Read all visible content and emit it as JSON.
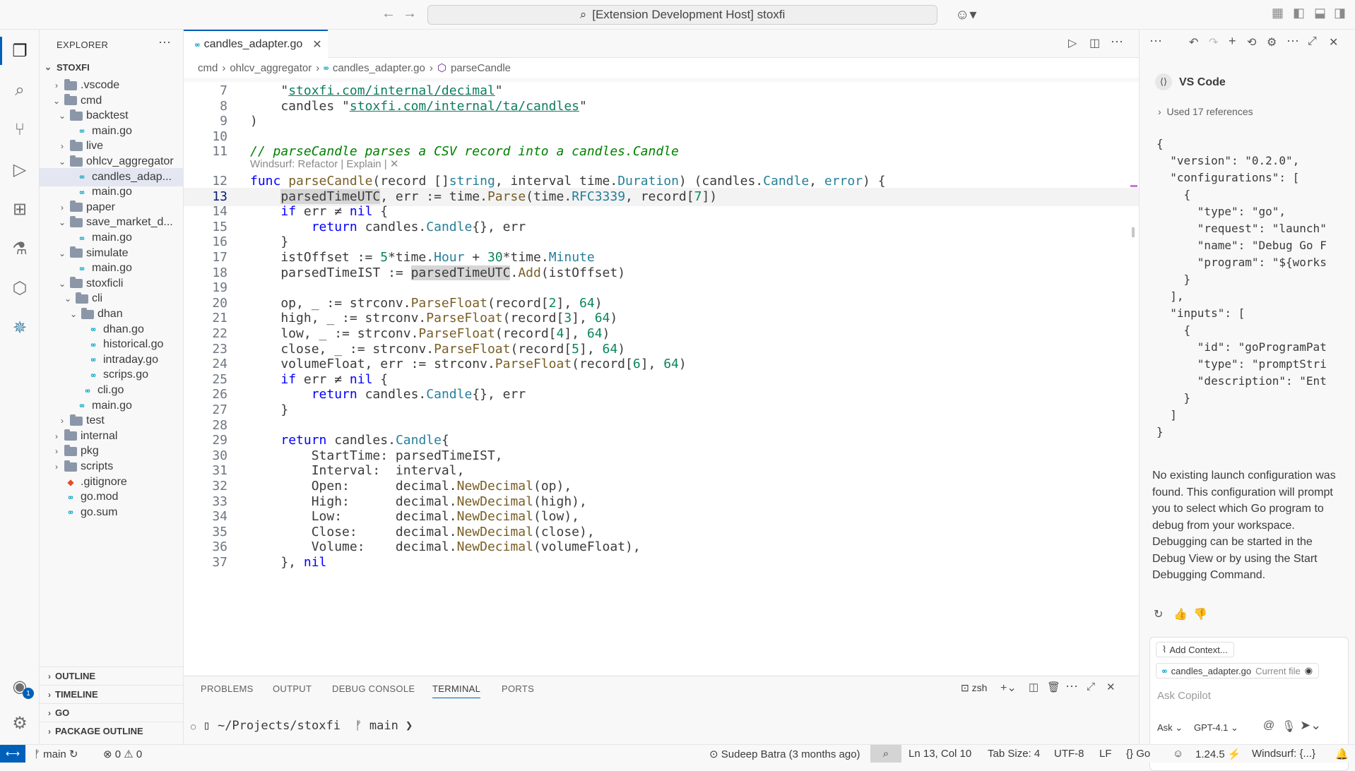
{
  "title_bar": {
    "command_center": "[Extension Development Host] stoxfi"
  },
  "explorer": {
    "header": "EXPLORER",
    "root": "STOXFI",
    "items": [
      {
        "label": ".vscode",
        "depth": 1,
        "kind": "folder",
        "open": false
      },
      {
        "label": "cmd",
        "depth": 1,
        "kind": "folder",
        "open": true
      },
      {
        "label": "backtest",
        "depth": 2,
        "kind": "folder",
        "open": true
      },
      {
        "label": "main.go",
        "depth": 3,
        "kind": "go"
      },
      {
        "label": "live",
        "depth": 2,
        "kind": "folder",
        "open": false
      },
      {
        "label": "ohlcv_aggregator",
        "depth": 2,
        "kind": "folder",
        "open": true
      },
      {
        "label": "candles_adap...",
        "depth": 3,
        "kind": "go",
        "selected": true
      },
      {
        "label": "main.go",
        "depth": 3,
        "kind": "go"
      },
      {
        "label": "paper",
        "depth": 2,
        "kind": "folder",
        "open": false
      },
      {
        "label": "save_market_d...",
        "depth": 2,
        "kind": "folder",
        "open": true
      },
      {
        "label": "main.go",
        "depth": 3,
        "kind": "go"
      },
      {
        "label": "simulate",
        "depth": 2,
        "kind": "folder",
        "open": true
      },
      {
        "label": "main.go",
        "depth": 3,
        "kind": "go"
      },
      {
        "label": "stoxficli",
        "depth": 2,
        "kind": "folder",
        "open": true
      },
      {
        "label": "cli",
        "depth": 3,
        "kind": "folder",
        "open": true
      },
      {
        "label": "dhan",
        "depth": 4,
        "kind": "folder",
        "open": true
      },
      {
        "label": "dhan.go",
        "depth": 5,
        "kind": "go"
      },
      {
        "label": "historical.go",
        "depth": 5,
        "kind": "go"
      },
      {
        "label": "intraday.go",
        "depth": 5,
        "kind": "go"
      },
      {
        "label": "scrips.go",
        "depth": 5,
        "kind": "go"
      },
      {
        "label": "cli.go",
        "depth": 4,
        "kind": "go"
      },
      {
        "label": "main.go",
        "depth": 3,
        "kind": "go"
      },
      {
        "label": "test",
        "depth": 2,
        "kind": "folder",
        "open": false
      },
      {
        "label": "internal",
        "depth": 1,
        "kind": "folder",
        "open": false
      },
      {
        "label": "pkg",
        "depth": 1,
        "kind": "folder",
        "open": false
      },
      {
        "label": "scripts",
        "depth": 1,
        "kind": "folder",
        "open": false
      },
      {
        "label": ".gitignore",
        "depth": 1,
        "kind": "git"
      },
      {
        "label": "go.mod",
        "depth": 1,
        "kind": "go"
      },
      {
        "label": "go.sum",
        "depth": 1,
        "kind": "go"
      }
    ],
    "sections": [
      "OUTLINE",
      "TIMELINE",
      "GO",
      "PACKAGE OUTLINE"
    ]
  },
  "editor": {
    "tab_label": "candles_adapter.go",
    "breadcrumb": [
      "cmd",
      "ohlcv_aggregator",
      "candles_adapter.go",
      "parseCandle"
    ],
    "codelens": "Windsurf: Refactor | Explain | ✕",
    "lines": [
      {
        "n": "7",
        "text": "    \"stoxfi.com/internal/decimal\""
      },
      {
        "n": "8",
        "text": "    candles \"stoxfi.com/internal/ta/candles\""
      },
      {
        "n": "9",
        "text": ")"
      },
      {
        "n": "10",
        "text": ""
      },
      {
        "n": "11",
        "text": "// parseCandle parses a CSV record into a candles.Candle"
      },
      {
        "n": "12",
        "text": "func parseCandle(record []string, interval time.Duration) (candles.Candle, error) {"
      },
      {
        "n": "13",
        "text": "    parsedTimeUTC, err := time.Parse(time.RFC3339, record[7])"
      },
      {
        "n": "14",
        "text": "    if err ≠ nil {"
      },
      {
        "n": "15",
        "text": "        return candles.Candle{}, err"
      },
      {
        "n": "16",
        "text": "    }"
      },
      {
        "n": "17",
        "text": "    istOffset := 5*time.Hour + 30*time.Minute"
      },
      {
        "n": "18",
        "text": "    parsedTimeIST := parsedTimeUTC.Add(istOffset)"
      },
      {
        "n": "19",
        "text": ""
      },
      {
        "n": "20",
        "text": "    op, _ := strconv.ParseFloat(record[2], 64)"
      },
      {
        "n": "21",
        "text": "    high, _ := strconv.ParseFloat(record[3], 64)"
      },
      {
        "n": "22",
        "text": "    low, _ := strconv.ParseFloat(record[4], 64)"
      },
      {
        "n": "23",
        "text": "    close, _ := strconv.ParseFloat(record[5], 64)"
      },
      {
        "n": "24",
        "text": "    volumeFloat, err := strconv.ParseFloat(record[6], 64)"
      },
      {
        "n": "25",
        "text": "    if err ≠ nil {"
      },
      {
        "n": "26",
        "text": "        return candles.Candle{}, err"
      },
      {
        "n": "27",
        "text": "    }"
      },
      {
        "n": "28",
        "text": ""
      },
      {
        "n": "29",
        "text": "    return candles.Candle{"
      },
      {
        "n": "30",
        "text": "        StartTime: parsedTimeIST,"
      },
      {
        "n": "31",
        "text": "        Interval:  interval,"
      },
      {
        "n": "32",
        "text": "        Open:      decimal.NewDecimal(op),"
      },
      {
        "n": "33",
        "text": "        High:      decimal.NewDecimal(high),"
      },
      {
        "n": "34",
        "text": "        Low:       decimal.NewDecimal(low),"
      },
      {
        "n": "35",
        "text": "        Close:     decimal.NewDecimal(close),"
      },
      {
        "n": "36",
        "text": "        Volume:    decimal.NewDecimal(volumeFloat),"
      },
      {
        "n": "37",
        "text": "    }, nil"
      }
    ]
  },
  "panel": {
    "tabs": [
      "PROBLEMS",
      "OUTPUT",
      "DEBUG CONSOLE",
      "TERMINAL",
      "PORTS"
    ],
    "active_tab": "TERMINAL",
    "shell": "zsh",
    "prompt": "~/Projects/stoxfi",
    "branch": "main"
  },
  "chat": {
    "author": "VS Code",
    "references": "Used 17 references",
    "json_lines": [
      "{",
      "  \"version\": \"0.2.0\",",
      "  \"configurations\": [",
      "    {",
      "      \"type\": \"go\",",
      "      \"request\": \"launch\"",
      "      \"name\": \"Debug Go F",
      "      \"program\": \"${works",
      "    }",
      "  ],",
      "  \"inputs\": [",
      "    {",
      "      \"id\": \"goProgramPat",
      "      \"type\": \"promptStri",
      "      \"description\": \"Ent",
      "    }",
      "  ]",
      "}"
    ],
    "message": "No existing launch configuration was found. This configuration will prompt you to select which Go program to debug from your workspace. Debugging can be started in the Debug View or by using the Start Debugging Command.",
    "add_context": "Add Context...",
    "context_file": "candles_adapter.go",
    "context_file_note": "Current file",
    "input_placeholder": "Ask Copilot",
    "mode": "Ask",
    "model": "GPT-4.1"
  },
  "status": {
    "branch": "main",
    "errors": "0",
    "warnings": "0",
    "blame": "Sudeep Batra (3 months ago)",
    "position": "Ln 13, Col 10",
    "tab_size": "Tab Size: 4",
    "encoding": "UTF-8",
    "eol": "LF",
    "language": "Go",
    "go_version": "1.24.5",
    "windsurf": "Windsurf: {...}",
    "accounts_badge": "1"
  }
}
